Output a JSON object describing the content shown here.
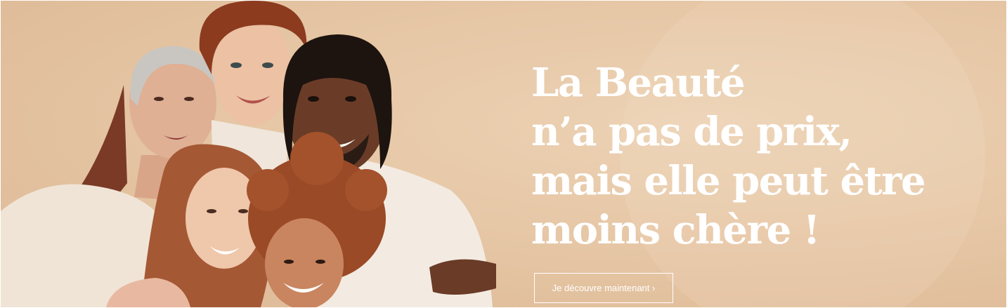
{
  "hero": {
    "headline": [
      "La Beauté",
      "n’a pas de prix,",
      "mais elle peut être",
      "moins chère !"
    ],
    "cta_label": "Je découvre maintenant ›",
    "background_color": "#e6c7a6",
    "headline_color": "#ffffff"
  }
}
